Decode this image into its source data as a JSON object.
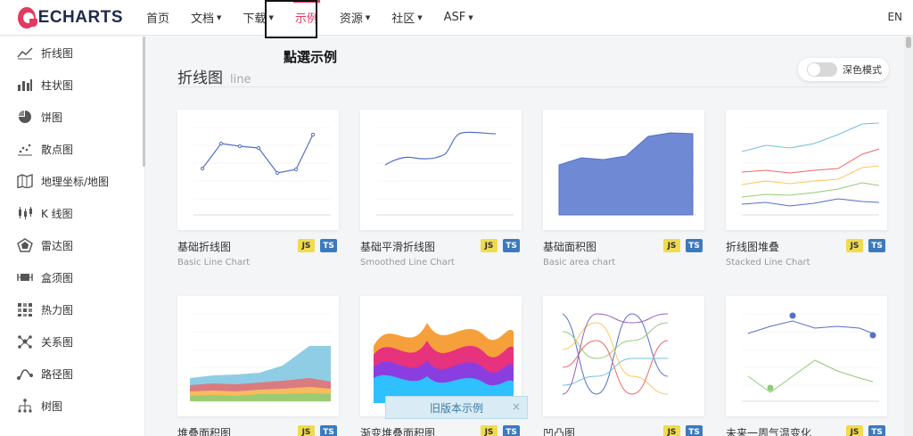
{
  "brand": {
    "logo_text": "ECHARTS",
    "accent": "#e43961"
  },
  "nav": {
    "items": [
      {
        "label": "首页",
        "dropdown": false
      },
      {
        "label": "文档",
        "dropdown": true
      },
      {
        "label": "下载",
        "dropdown": true
      },
      {
        "label": "示例",
        "dropdown": false,
        "active": true
      },
      {
        "label": "资源",
        "dropdown": true
      },
      {
        "label": "社区",
        "dropdown": true
      },
      {
        "label": "ASF",
        "dropdown": true
      }
    ],
    "lang": "EN"
  },
  "annotation": "點選示例",
  "sidebar": {
    "items": [
      {
        "label": "折线图",
        "icon": "line-chart-icon"
      },
      {
        "label": "柱状图",
        "icon": "bar-chart-icon"
      },
      {
        "label": "饼图",
        "icon": "pie-chart-icon"
      },
      {
        "label": "散点图",
        "icon": "scatter-chart-icon"
      },
      {
        "label": "地理坐标/地图",
        "icon": "map-icon"
      },
      {
        "label": "K 线图",
        "icon": "candlestick-icon"
      },
      {
        "label": "雷达图",
        "icon": "radar-icon"
      },
      {
        "label": "盒须图",
        "icon": "boxplot-icon"
      },
      {
        "label": "热力图",
        "icon": "heatmap-icon"
      },
      {
        "label": "关系图",
        "icon": "graph-icon"
      },
      {
        "label": "路径图",
        "icon": "lines-icon"
      },
      {
        "label": "树图",
        "icon": "tree-icon"
      }
    ]
  },
  "main": {
    "title": "折线图",
    "subtitle": "line",
    "dark_mode_label": "深色模式",
    "dark_mode_on": false
  },
  "cards": [
    {
      "title": "基础折线图",
      "subtitle": "Basic Line Chart",
      "js": "JS",
      "ts": "TS"
    },
    {
      "title": "基础平滑折线图",
      "subtitle": "Smoothed Line Chart",
      "js": "JS",
      "ts": "TS"
    },
    {
      "title": "基础面积图",
      "subtitle": "Basic area chart",
      "js": "JS",
      "ts": "TS"
    },
    {
      "title": "折线图堆叠",
      "subtitle": "Stacked Line Chart",
      "js": "JS",
      "ts": "TS"
    },
    {
      "title": "堆叠面积图",
      "subtitle": "",
      "js": "JS",
      "ts": "TS"
    },
    {
      "title": "渐变堆叠面积图",
      "subtitle": "",
      "js": "JS",
      "ts": "TS"
    },
    {
      "title": "凹凸图",
      "subtitle": "",
      "js": "JS",
      "ts": "TS"
    },
    {
      "title": "未来一周气温变化",
      "subtitle": "",
      "js": "JS",
      "ts": "TS"
    }
  ],
  "toast": {
    "label": "旧版本示例",
    "close": "×"
  }
}
